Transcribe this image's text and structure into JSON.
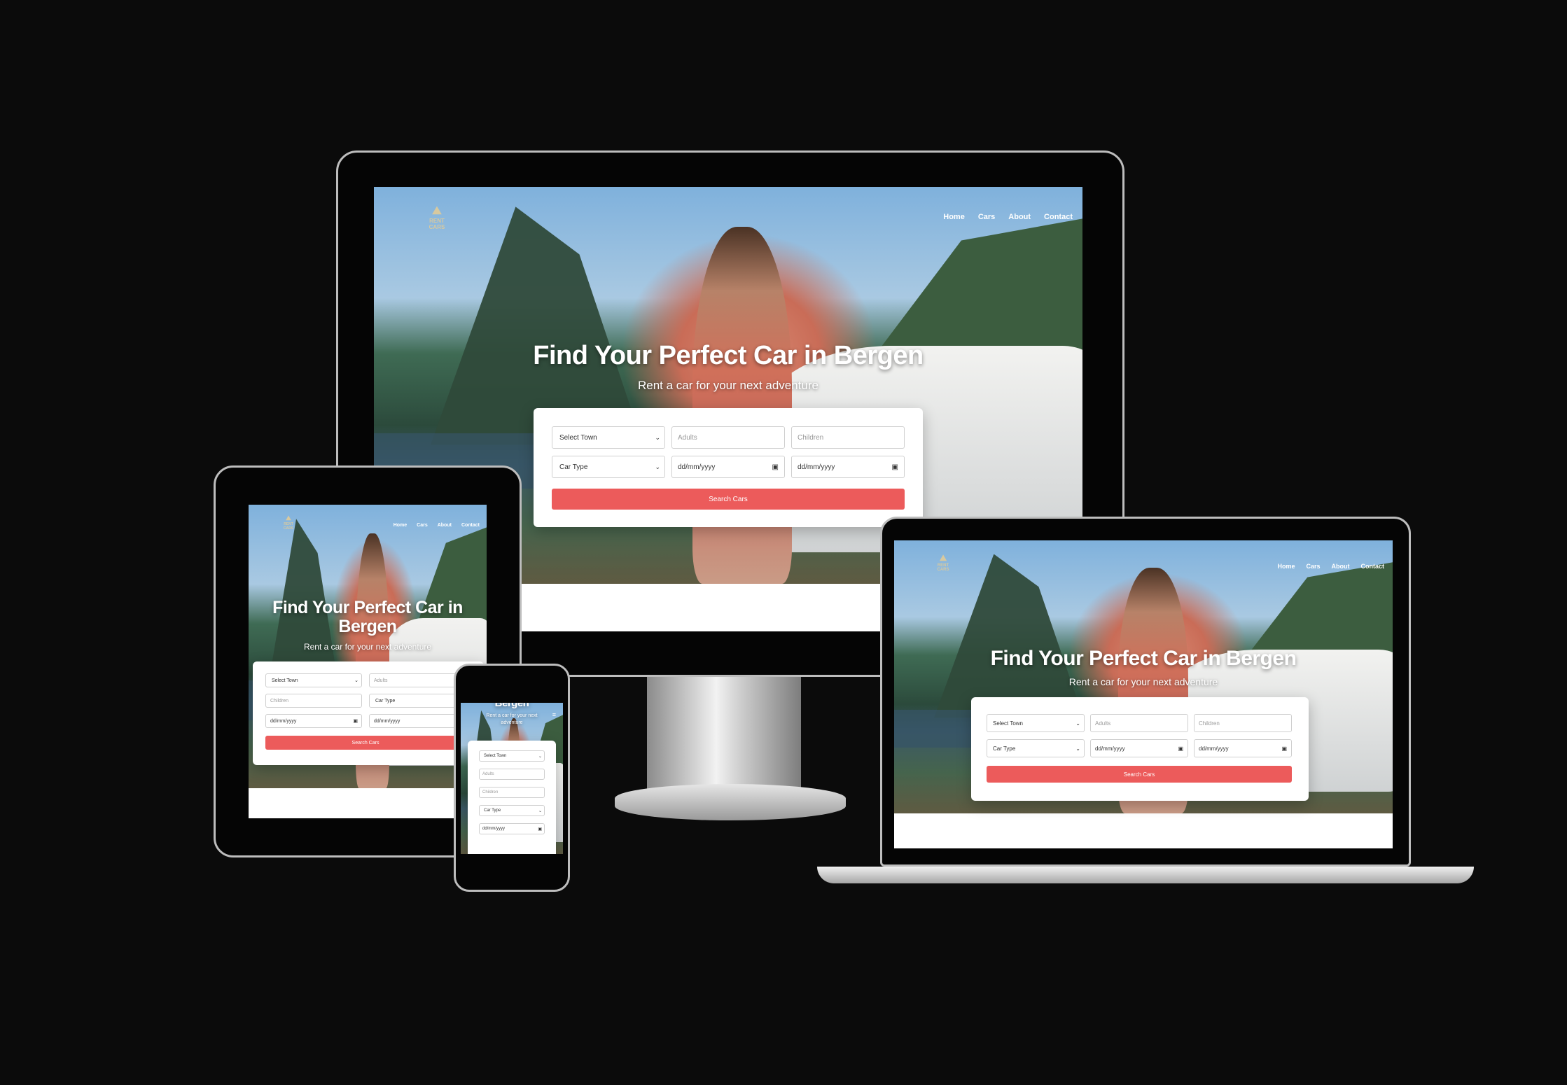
{
  "site": {
    "logo_text": "RENT CARS",
    "nav": [
      "Home",
      "Cars",
      "About",
      "Contact"
    ],
    "hero_title": "Find Your Perfect Car in Bergen",
    "hero_title_line1": "Find Your Perfect Car in",
    "hero_title_line2": "Bergen",
    "hero_sub": "Rent a car for your next adventure",
    "phone_sub_line1": "Rent a car for your next",
    "phone_sub_line2": "adventure",
    "form": {
      "town": "Select Town",
      "adults": "Adults",
      "children": "Children",
      "car_type": "Car Type",
      "date_from": "dd/mm/yyyy",
      "date_to": "dd/mm/yyyy",
      "search": "Search Cars"
    },
    "icons": {
      "chevron": "chevron-down-icon",
      "calendar": "calendar-icon",
      "menu": "hamburger-icon"
    },
    "colors": {
      "accent": "#ec5b5b",
      "background": "#0b0b0b"
    }
  }
}
